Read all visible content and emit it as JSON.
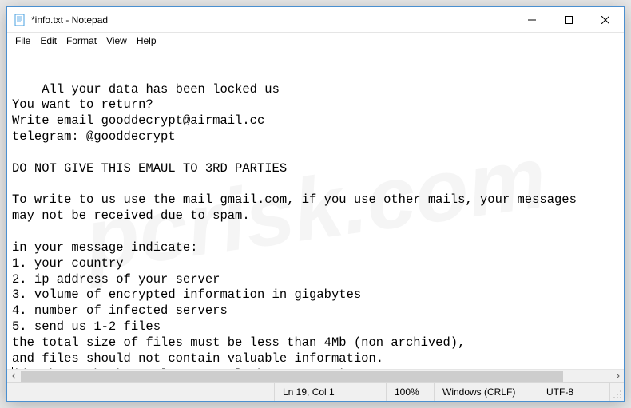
{
  "titlebar": {
    "title": "*info.txt - Notepad"
  },
  "menu": {
    "file": "File",
    "edit": "Edit",
    "format": "Format",
    "view": "View",
    "help": "Help"
  },
  "content": {
    "lines": [
      "All your data has been locked us",
      "You want to return?",
      "Write email gooddecrypt@airmail.cc",
      "telegram: @gooddecrypt",
      "",
      "DO NOT GIVE THIS EMAUL TO 3RD PARTIES",
      "",
      "To write to us use the mail gmail.com, if you use other mails, your messages",
      "may not be received due to spam.",
      "",
      "in your message indicate:",
      "1. your country",
      "2. ip address of your server",
      "3. volume of encrypted information in gigabytes",
      "4. number of infected servers",
      "5. send us 1-2 files",
      "the total size of files must be less than 4Mb (non archived),",
      "and files should not contain valuable information.",
      "(databases,backups, large excel sheets, etc.)"
    ]
  },
  "statusbar": {
    "position": "Ln 19, Col 1",
    "zoom": "100%",
    "lineending": "Windows (CRLF)",
    "encoding": "UTF-8"
  },
  "watermark": "pcrisk.com"
}
